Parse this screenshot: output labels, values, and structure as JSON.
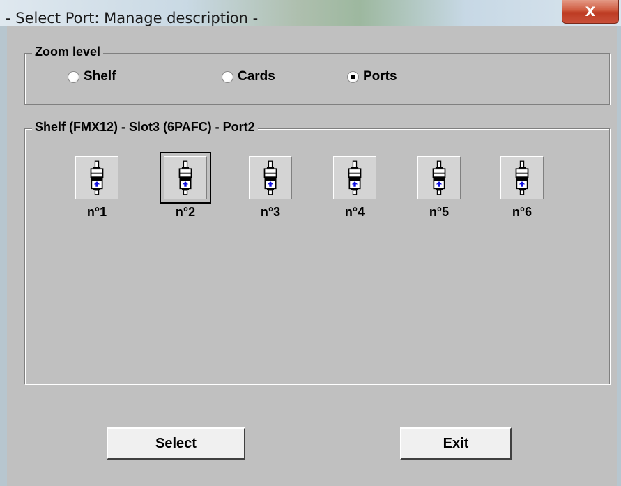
{
  "window": {
    "title": "- Select Port: Manage description -",
    "close_symbol": "X"
  },
  "zoom": {
    "legend": "Zoom level",
    "options": [
      {
        "label": "Shelf",
        "selected": false
      },
      {
        "label": "Cards",
        "selected": false
      },
      {
        "label": "Ports",
        "selected": true
      }
    ]
  },
  "ports_group": {
    "legend": "Shelf (FMX12) - Slot3 (6PAFC) - Port2",
    "ports": [
      {
        "label": "n°1",
        "icon": "port-connector-icon",
        "selected": false
      },
      {
        "label": "n°2",
        "icon": "port-connector-icon",
        "selected": true
      },
      {
        "label": "n°3",
        "icon": "port-connector-icon",
        "selected": false
      },
      {
        "label": "n°4",
        "icon": "port-connector-icon",
        "selected": false
      },
      {
        "label": "n°5",
        "icon": "port-connector-icon",
        "selected": false
      },
      {
        "label": "n°6",
        "icon": "port-connector-icon",
        "selected": false
      }
    ]
  },
  "buttons": {
    "select": "Select",
    "exit": "Exit"
  },
  "colors": {
    "dialog_bg": "#c0c0c0",
    "close_button": "#c9503a",
    "port_arrow": "#1010e0"
  }
}
